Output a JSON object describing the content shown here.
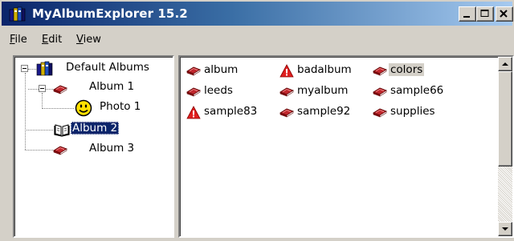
{
  "window": {
    "title": "MyAlbumExplorer 15.2"
  },
  "menu": [
    {
      "label": "File"
    },
    {
      "label": "Edit"
    },
    {
      "label": "View"
    }
  ],
  "tree": {
    "root": "Default Albums",
    "album1": "Album 1",
    "photo1": "Photo 1",
    "album2": "Album 2",
    "album3": "Album 3"
  },
  "list": [
    {
      "label": "album",
      "icon": "book-icon"
    },
    {
      "label": "badalbum",
      "icon": "warning-icon"
    },
    {
      "label": "colors",
      "icon": "book-icon"
    },
    {
      "label": "leeds",
      "icon": "book-icon"
    },
    {
      "label": "myalbum",
      "icon": "book-icon"
    },
    {
      "label": "sample66",
      "icon": "book-icon"
    },
    {
      "label": "sample83",
      "icon": "warning-icon"
    },
    {
      "label": "sample92",
      "icon": "book-icon"
    },
    {
      "label": "supplies",
      "icon": "book-icon"
    }
  ],
  "colors": {
    "title_start": "#0a246a",
    "selection": "#0a246a",
    "face": "#d4d0c8",
    "book": "#c0272d",
    "warning": "#e02020"
  }
}
